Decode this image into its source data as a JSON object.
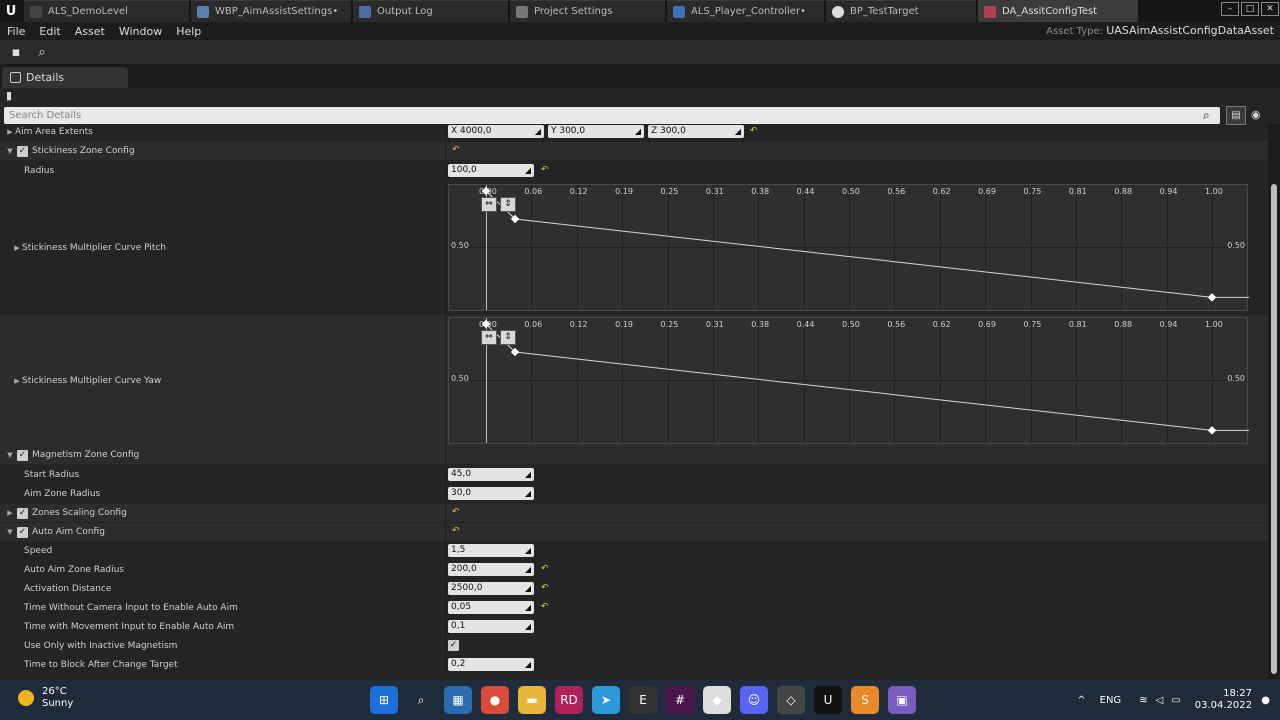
{
  "tabs": [
    {
      "label": "ALS_DemoLevel",
      "icon": "level-icon",
      "color": "#444"
    },
    {
      "label": "WBP_AimAssistSettings•",
      "icon": "widget-blueprint-icon",
      "color": "#5a7fb0"
    },
    {
      "label": "Output Log",
      "icon": "output-log-icon",
      "color": "#4a6fa0"
    },
    {
      "label": "Project Settings",
      "icon": "gear-icon",
      "color": "#777"
    },
    {
      "label": "ALS_Player_Controller•",
      "icon": "blueprint-icon",
      "color": "#3f6fb5"
    },
    {
      "label": "BP_TestTarget",
      "icon": "blueprint-actor-icon",
      "color": "#dcdcdc"
    },
    {
      "label": "DA_AssitConfigTest",
      "icon": "data-asset-icon",
      "color": "#b04050"
    }
  ],
  "menu": [
    "File",
    "Edit",
    "Asset",
    "Window",
    "Help"
  ],
  "asset_type": {
    "prefix": "Asset Type:",
    "name": "UASAimAssistConfigDataAsset"
  },
  "details_tab": "Details",
  "search_placeholder": "Search Details",
  "properties": {
    "aim_area_extents": {
      "label": "Aim Area Extents",
      "x": "X  4000,0",
      "y": "Y  300,0",
      "z": "Z  300,0"
    },
    "stickiness_zone": {
      "label": "Stickiness Zone Config",
      "checked": true
    },
    "radius": {
      "label": "Radius",
      "value": "100,0"
    },
    "curve_pitch": {
      "label": "Stickiness Multiplier Curve Pitch"
    },
    "curve_yaw": {
      "label": "Stickiness Multiplier Curve Yaw"
    },
    "magnetism_zone": {
      "label": "Magnetism Zone Config",
      "checked": true
    },
    "start_radius": {
      "label": "Start Radius",
      "value": "45,0"
    },
    "aim_zone_radius": {
      "label": "Aim Zone Radius",
      "value": "30,0"
    },
    "zones_scaling": {
      "label": "Zones Scaling Config",
      "checked": true
    },
    "auto_aim": {
      "label": "Auto Aim Config",
      "checked": true
    },
    "speed": {
      "label": "Speed",
      "value": "1,5"
    },
    "auto_aim_zone_radius": {
      "label": "Auto Aim Zone Radius",
      "value": "200,0"
    },
    "activation_distance": {
      "label": "Activation Distance",
      "value": "2500,0"
    },
    "time_without_camera": {
      "label": "Time Without Camera Input to Enable Auto Aim",
      "value": "0,05"
    },
    "time_with_movement": {
      "label": "Time with Movement Input to Enable Auto Aim",
      "value": "0,1"
    },
    "use_only_inactive": {
      "label": "Use Only with Inactive Magnetism",
      "checked": true
    },
    "time_to_block": {
      "label": "Time to Block After Change Target",
      "value": "0,2"
    }
  },
  "curve_ticks": [
    "0.00",
    "0.06",
    "0.12",
    "0.19",
    "0.25",
    "0.31",
    "0.38",
    "0.44",
    "0.50",
    "0.56",
    "0.62",
    "0.69",
    "0.75",
    "0.81",
    "0.88",
    "0.94",
    "1.00"
  ],
  "curve_y_label": "0.50",
  "chart_data": [
    {
      "type": "line",
      "series": [
        {
          "x": [
            0.0,
            0.04,
            1.0
          ],
          "y": [
            1.0,
            0.75,
            0.05
          ]
        }
      ],
      "xlim": [
        0,
        1
      ],
      "y_tick_label": "0.50"
    },
    {
      "type": "line",
      "series": [
        {
          "x": [
            0.0,
            0.04,
            1.0
          ],
          "y": [
            1.0,
            0.75,
            0.05
          ]
        }
      ],
      "xlim": [
        0,
        1
      ],
      "y_tick_label": "0.50"
    }
  ],
  "taskbar": {
    "temperature": "26°C",
    "weather": "Sunny",
    "apps": [
      {
        "icon": "windows-start-icon",
        "color": "#1e6fd8",
        "glyph": "⊞"
      },
      {
        "icon": "search-icon",
        "color": "transparent",
        "glyph": "⌕"
      },
      {
        "icon": "photos-icon",
        "color": "#2b6cb0",
        "glyph": "▦"
      },
      {
        "icon": "chrome-icon",
        "color": "#d94a3a",
        "glyph": "●"
      },
      {
        "icon": "file-explorer-icon",
        "color": "#e8b43a",
        "glyph": "▬"
      },
      {
        "icon": "rider-icon",
        "color": "#b0205a",
        "glyph": "RD"
      },
      {
        "icon": "telegram-icon",
        "color": "#2a9ad8",
        "glyph": "➤"
      },
      {
        "icon": "epic-games-icon",
        "color": "#333",
        "glyph": "E"
      },
      {
        "icon": "slack-icon",
        "color": "#4a154b",
        "glyph": "#"
      },
      {
        "icon": "code-editor-icon",
        "color": "#ddd",
        "glyph": "◆"
      },
      {
        "icon": "discord-icon",
        "color": "#5865f2",
        "glyph": "☺"
      },
      {
        "icon": "unity-icon",
        "color": "#444",
        "glyph": "◇"
      },
      {
        "icon": "unreal-icon",
        "color": "#111",
        "glyph": "U"
      },
      {
        "icon": "sublime-icon",
        "color": "#e8892a",
        "glyph": "S"
      },
      {
        "icon": "visual-studio-icon",
        "color": "#7a5cc0",
        "glyph": "▣"
      }
    ],
    "lang": "ENG",
    "time": "18:27",
    "date": "03.04.2022"
  }
}
